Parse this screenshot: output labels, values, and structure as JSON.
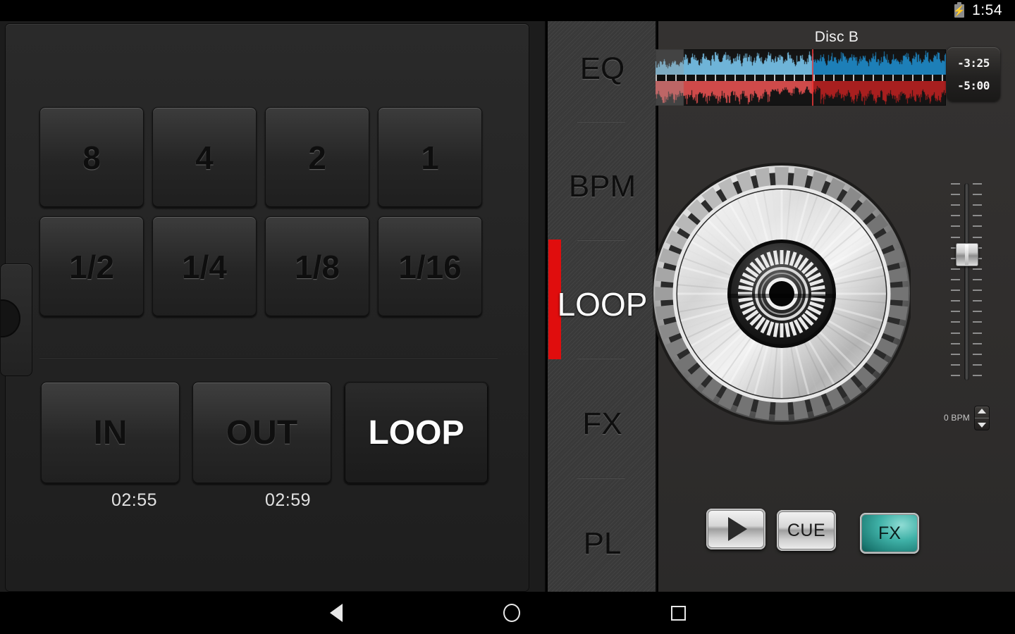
{
  "statusbar": {
    "clock": "1:54",
    "battery_icon": "battery-charging-icon",
    "bolt_glyph": "⚡"
  },
  "navbar": {
    "back_icon": "back-triangle-icon",
    "home_icon": "home-circle-icon",
    "recents_icon": "recents-square-icon"
  },
  "left_deck": {
    "edge_widget": {
      "play_arrow_icon": "play-arrow-icon",
      "accent": "#22b4e8"
    },
    "loop_grid": {
      "row1": [
        "8",
        "4",
        "2",
        "1"
      ],
      "row2": [
        "1/2",
        "1/4",
        "1/8",
        "1/16"
      ]
    },
    "controls": {
      "in_label": "IN",
      "out_label": "OUT",
      "loop_label": "LOOP",
      "in_time": "02:55",
      "out_time": "02:59",
      "active": "LOOP"
    }
  },
  "rail": {
    "items": [
      {
        "label": "EQ",
        "active": false
      },
      {
        "label": "BPM",
        "active": false
      },
      {
        "label": "LOOP",
        "active": true
      },
      {
        "label": "FX",
        "active": false
      },
      {
        "label": "PL",
        "active": false
      }
    ],
    "active_indicator_color": "#e00d0d"
  },
  "right_deck": {
    "title": "Disc B",
    "time_remaining": "-3:25",
    "time_total": "-5:00",
    "waveform": {
      "top_color": "#1d7fb8",
      "top_played_color": "#6fb4d8",
      "bottom_color": "#a81f1f",
      "bottom_played_color": "#cf4a4a",
      "playhead_position_pct": 54,
      "beatgrid": true
    },
    "jog_wheel": {
      "icon": "jog-wheel-icon",
      "label": "jog wheel platter"
    },
    "pitch_fader": {
      "icon": "pitch-fader-icon",
      "value_pct": 34,
      "ticks": 19
    },
    "bpm": {
      "value": "0 BPM",
      "stepper_up_icon": "caret-up-icon",
      "stepper_down_icon": "caret-down-icon"
    },
    "transport": {
      "play_label": "",
      "play_icon": "play-triangle-icon",
      "cue_label": "CUE",
      "fx_label": "FX",
      "fx_active": true,
      "fx_color": "#3fb1a7"
    }
  }
}
